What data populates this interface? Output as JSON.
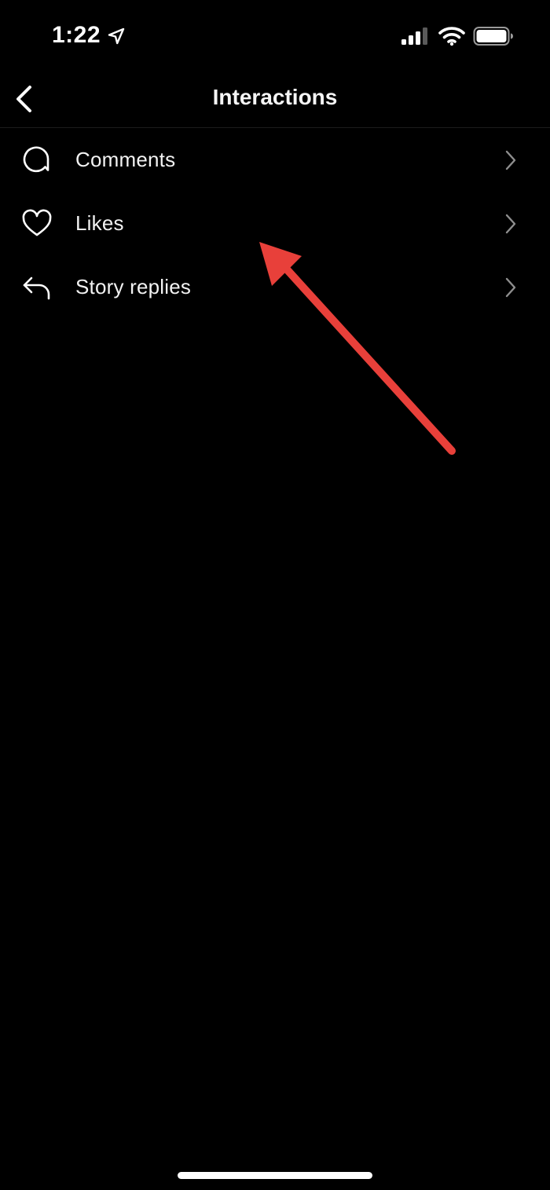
{
  "status_bar": {
    "time": "1:22",
    "icons": [
      "location-arrow-icon",
      "signal-icon",
      "wifi-icon",
      "battery-icon"
    ]
  },
  "header": {
    "back_icon": "chevron-left-icon",
    "title": "Interactions"
  },
  "menu": {
    "items": [
      {
        "label": "Comments",
        "icon": "comment-bubble-icon"
      },
      {
        "label": "Likes",
        "icon": "heart-icon"
      },
      {
        "label": "Story replies",
        "icon": "reply-arrow-icon"
      }
    ]
  },
  "annotation": {
    "type": "arrow",
    "color": "#e8403a",
    "points_to": "Likes"
  },
  "colors": {
    "background": "#000000",
    "text": "#ffffff",
    "chevron": "#8e8e8e",
    "annotation": "#e8403a"
  }
}
